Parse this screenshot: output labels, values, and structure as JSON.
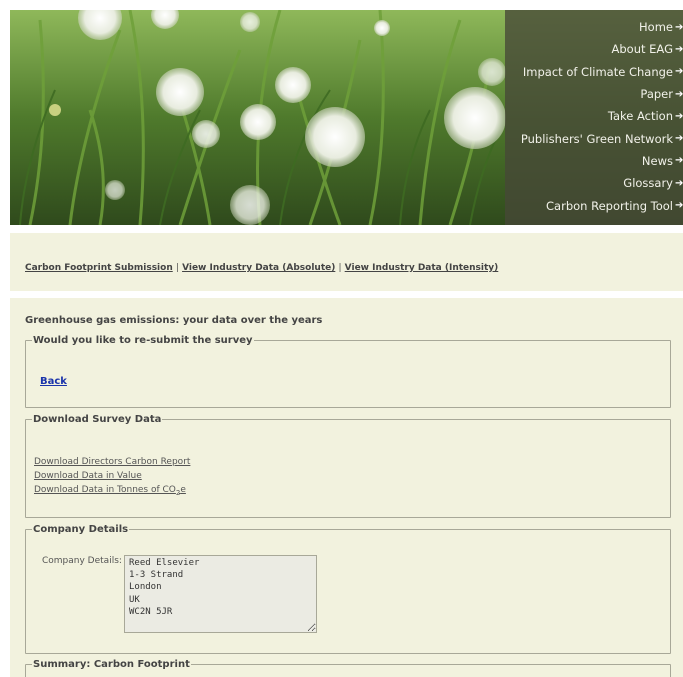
{
  "nav": {
    "items": [
      {
        "label": "Home",
        "icon": "arrow-right-icon"
      },
      {
        "label": "About EAG",
        "icon": "arrow-right-icon"
      },
      {
        "label": "Impact of Climate Change",
        "icon": "arrow-right-icon"
      },
      {
        "label": "Paper",
        "icon": "arrow-right-icon"
      },
      {
        "label": "Take Action",
        "icon": "arrow-right-icon"
      },
      {
        "label": "Publishers' Green Network",
        "icon": "arrow-right-icon"
      },
      {
        "label": "News",
        "icon": "arrow-right-icon"
      },
      {
        "label": "Glossary",
        "icon": "arrow-right-icon"
      },
      {
        "label": "Carbon Reporting Tool",
        "icon": "arrow-right-icon"
      }
    ]
  },
  "tabs": {
    "submission": "Carbon Footprint Submission",
    "sep1": "|",
    "absolute": "View Industry Data (Absolute)",
    "sep2": "|",
    "intensity": "View Industry Data (Intensity)"
  },
  "main": {
    "title": "Greenhouse gas emissions: your data over the years"
  },
  "resubmit": {
    "legend": "Would you like to re-submit the survey",
    "back_link": "Back"
  },
  "download": {
    "legend": "Download Survey Data",
    "directors_report": "Download Directors Carbon Report",
    "data_value": "Download Data in Value",
    "data_tonnes_prefix": "Download Data in Tonnes of CO",
    "data_tonnes_sub": "2",
    "data_tonnes_suffix": "e"
  },
  "company": {
    "legend": "Company Details",
    "label": "Company Details:",
    "value": "Reed Elsevier\n1-3 Strand\nLondon\nUK\nWC2N 5JR"
  },
  "summary": {
    "legend": "Summary: Carbon Footprint"
  },
  "colors": {
    "panel_bg": "#f2f2de",
    "nav_overlay": "#464837",
    "link_blue": "#1a33aa"
  }
}
